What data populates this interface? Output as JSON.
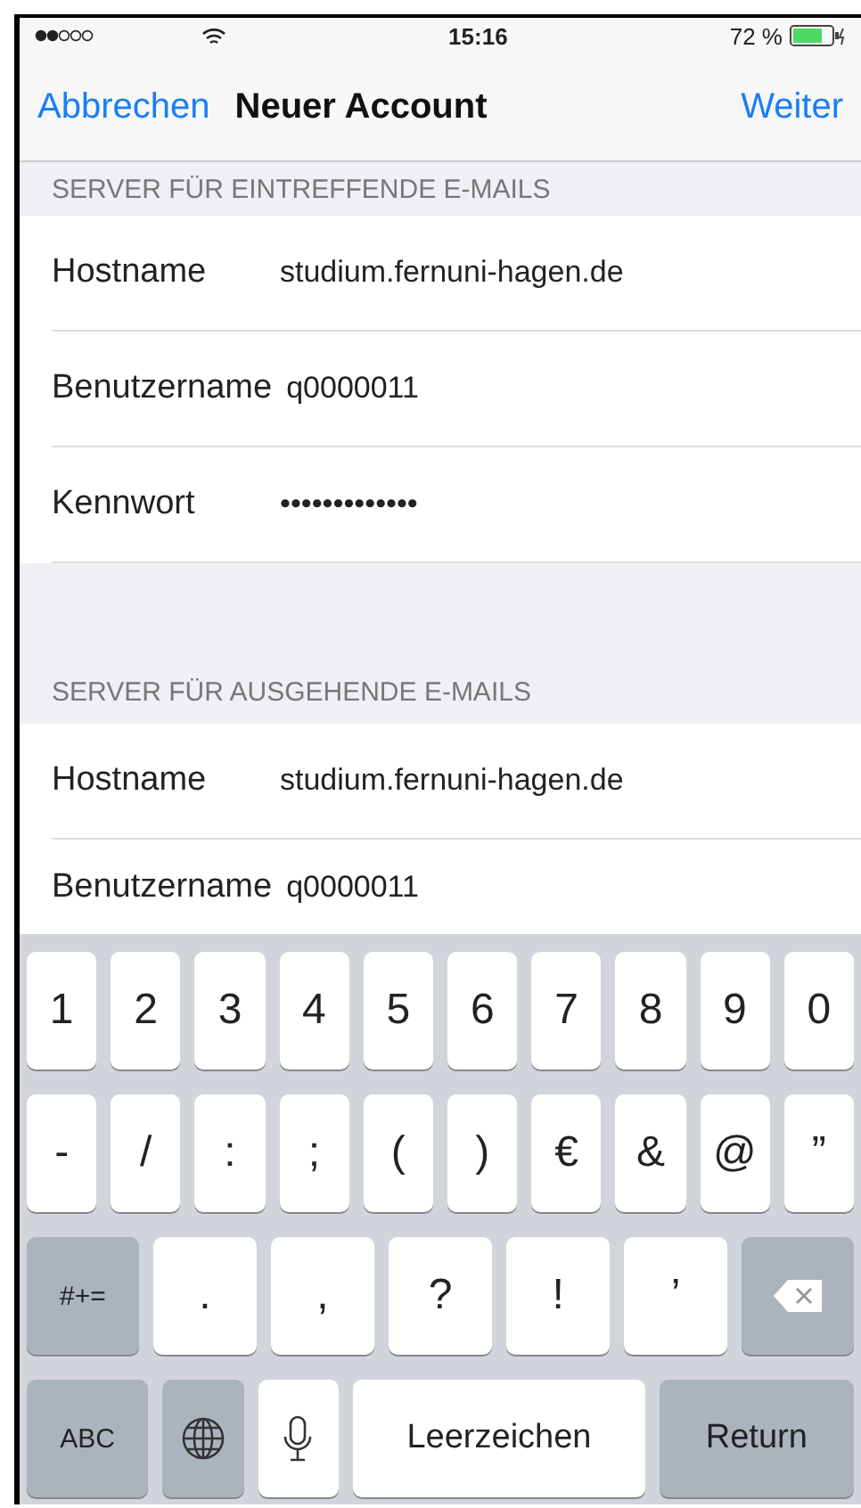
{
  "status_bar": {
    "time": "15:16",
    "battery": "72 %"
  },
  "nav": {
    "cancel": "Abbrechen",
    "title": "Neuer Account",
    "next": "Weiter"
  },
  "sections": [
    {
      "header": "SERVER FÜR EINTREFFENDE E-MAILS",
      "rows": [
        {
          "label": "Hostname",
          "value": "studium.fernuni-hagen.de"
        },
        {
          "label": "Benutzername",
          "value": "q0000011"
        },
        {
          "label": "Kennwort",
          "value": "•••••••••••••"
        }
      ]
    },
    {
      "header": "SERVER FÜR AUSGEHENDE E-MAILS",
      "rows": [
        {
          "label": "Hostname",
          "value": "studium.fernuni-hagen.de"
        },
        {
          "label": "Benutzername",
          "value": "q0000011"
        }
      ]
    }
  ],
  "keyboard": [
    [
      {
        "kind": "key",
        "label": "1"
      },
      {
        "kind": "key",
        "label": "2"
      },
      {
        "kind": "key",
        "label": "3"
      },
      {
        "kind": "key",
        "label": "4"
      },
      {
        "kind": "key",
        "label": "5"
      },
      {
        "kind": "key",
        "label": "6"
      },
      {
        "kind": "key",
        "label": "7"
      },
      {
        "kind": "key",
        "label": "8"
      },
      {
        "kind": "key",
        "label": "9"
      },
      {
        "kind": "key",
        "label": "0"
      }
    ],
    [
      {
        "kind": "key",
        "label": "-"
      },
      {
        "kind": "key",
        "label": "/"
      },
      {
        "kind": "key",
        "label": ":"
      },
      {
        "kind": "key",
        "label": ";"
      },
      {
        "kind": "key",
        "label": "("
      },
      {
        "kind": "key",
        "label": ")"
      },
      {
        "kind": "key",
        "label": "€"
      },
      {
        "kind": "key",
        "label": "&"
      },
      {
        "kind": "key",
        "label": "@"
      },
      {
        "kind": "key",
        "label": "”"
      }
    ],
    [
      {
        "kind": "fn",
        "label": "#+="
      },
      {
        "kind": "key",
        "label": "."
      },
      {
        "kind": "key",
        "label": ","
      },
      {
        "kind": "key",
        "label": "?"
      },
      {
        "kind": "key",
        "label": "!"
      },
      {
        "kind": "key",
        "label": "’"
      },
      {
        "kind": "delete"
      }
    ],
    [
      {
        "kind": "fn",
        "label": "ABC"
      },
      {
        "kind": "globe"
      },
      {
        "kind": "mic"
      },
      {
        "kind": "space",
        "label": "Leerzeichen"
      },
      {
        "kind": "fn",
        "label": "Return"
      }
    ]
  ]
}
